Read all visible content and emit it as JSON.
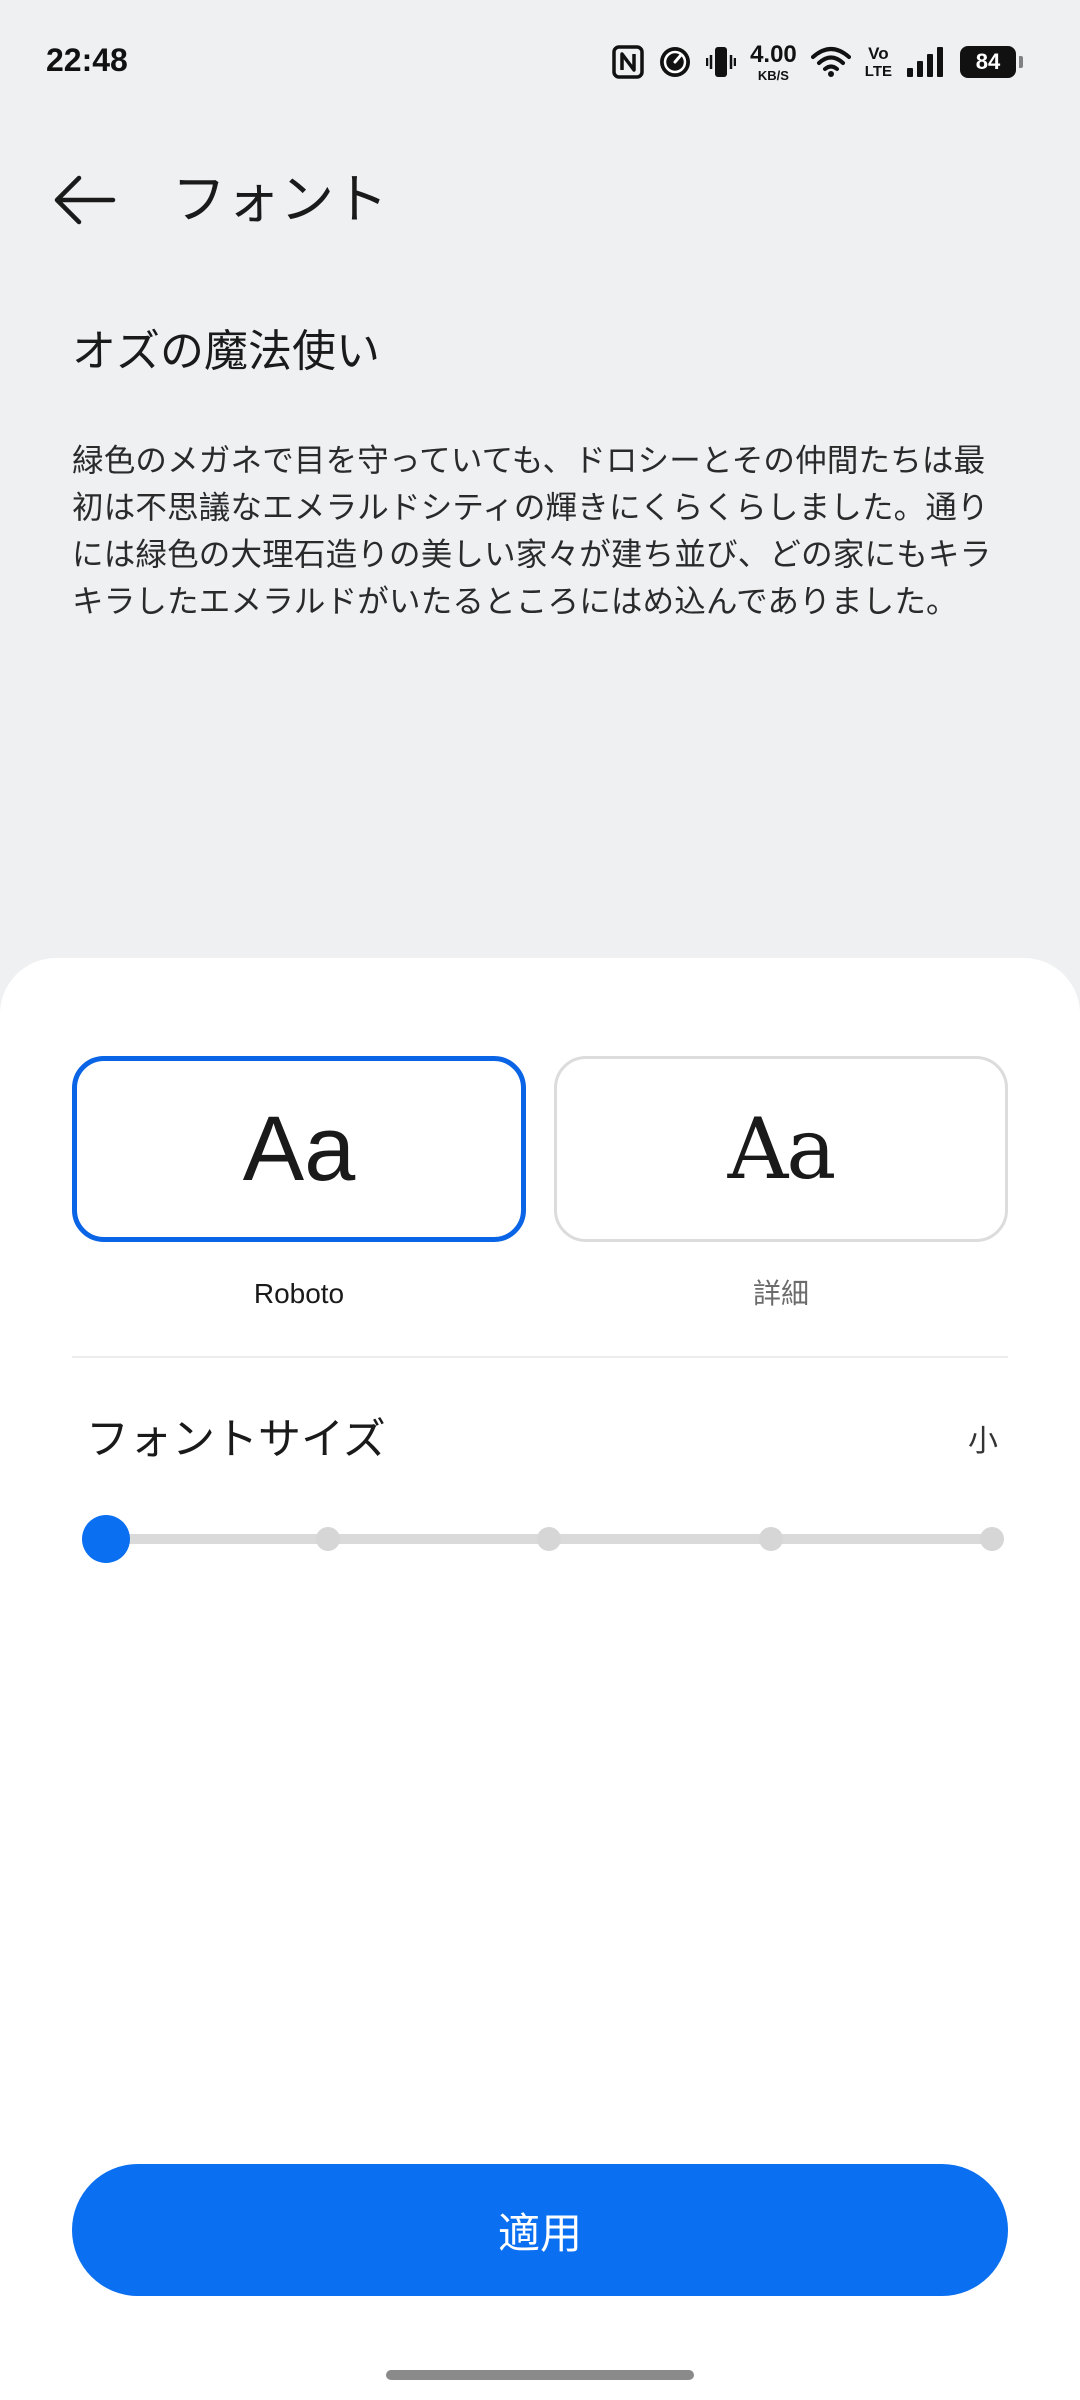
{
  "status_bar": {
    "time": "22:48",
    "net_speed_value": "4.00",
    "net_speed_unit": "KB/S",
    "volte_top": "Vo",
    "volte_bottom": "LTE",
    "battery": "84",
    "icons": [
      "nfc-icon",
      "speedometer-icon",
      "vibrate-icon",
      "wifi-icon",
      "signal-icon",
      "battery-icon"
    ]
  },
  "header": {
    "title": "フォント"
  },
  "preview": {
    "title": "オズの魔法使い",
    "body": "緑色のメガネで目を守っていても、ドロシーとその仲間たちは最初は不思議なエメラルドシティの輝きにくらくらしました。通りには緑色の大理石造りの美しい家々が建ち並び、どの家にもキラキラしたエメラルドがいたるところにはめ込んでありました。"
  },
  "font_options": [
    {
      "sample": "Aa",
      "label": "Roboto",
      "selected": true
    },
    {
      "sample": "Aa",
      "label": "詳細",
      "selected": false
    }
  ],
  "font_size": {
    "title": "フォントサイズ",
    "value": "小",
    "steps": 5,
    "selected_index": 0
  },
  "apply_label": "適用",
  "colors": {
    "accent": "#0a6ff0",
    "background": "#eff0f2",
    "sheet": "#ffffff"
  }
}
